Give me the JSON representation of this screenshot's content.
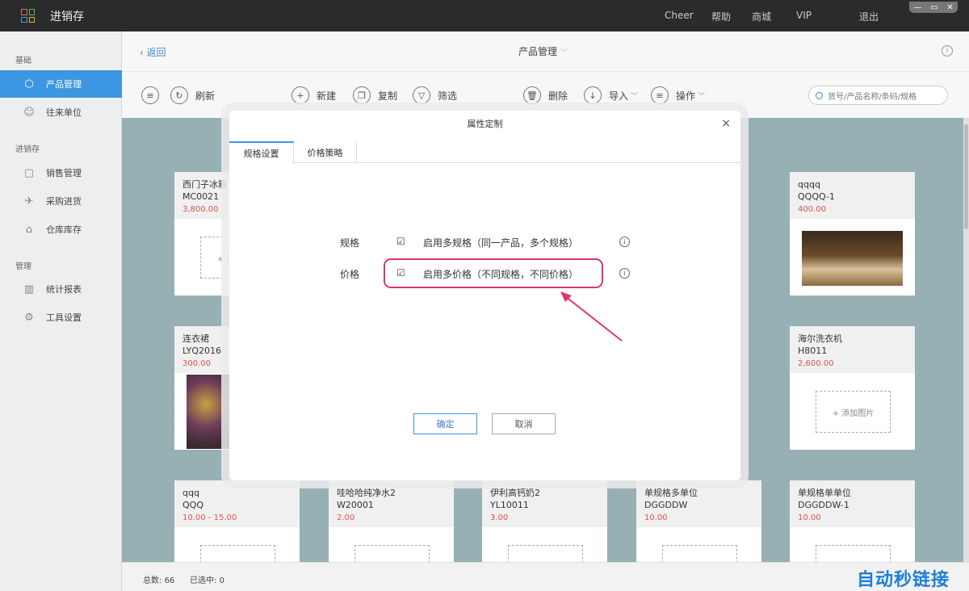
{
  "app": {
    "title": "进销存"
  },
  "topnav": {
    "items": [
      "Cheer",
      "帮助",
      "商城",
      "VIP",
      "退出"
    ],
    "win": [
      "—",
      "▭",
      "✕"
    ]
  },
  "sidebar": {
    "sections": [
      "基础",
      "进销存",
      "管理"
    ],
    "items": [
      {
        "label": "产品管理",
        "icon": "tag-icon"
      },
      {
        "label": "往来单位",
        "icon": "contacts-icon"
      },
      {
        "label": "销售管理",
        "icon": "clipboard-icon"
      },
      {
        "label": "采购进货",
        "icon": "plane-icon"
      },
      {
        "label": "仓库库存",
        "icon": "warehouse-icon"
      },
      {
        "label": "统计报表",
        "icon": "chart-icon"
      },
      {
        "label": "工具设置",
        "icon": "gear-icon"
      }
    ]
  },
  "header": {
    "back": "返回",
    "title": "产品管理",
    "title_suffix": "﹀"
  },
  "toolbar": {
    "refresh": "刷新",
    "new": "新建",
    "copy": "复制",
    "filter": "筛选",
    "delete": "删除",
    "import": "导入",
    "action": "操作",
    "search_placeholder": "货号/产品名称/条码/规格"
  },
  "cards": [
    {
      "name": "西门子冰箱",
      "code": "MC0021",
      "price": "3,800.00",
      "img": "add"
    },
    {
      "name": "qqqq",
      "code": "QQQQ-1",
      "price": "400.00",
      "img": "book"
    },
    {
      "name": "连衣裙",
      "code": "LYQ2016",
      "price": "300.00",
      "img": "photo"
    },
    {
      "name": "海尔洗衣机",
      "code": "H8011",
      "price": "2,600.00",
      "img": "add"
    },
    {
      "name": "qqq",
      "code": "QQQ",
      "price": "10.00 - 15.00",
      "img": "add"
    },
    {
      "name": "哇哈哈纯净水2",
      "code": "W20001",
      "price": "2.00",
      "img": "add"
    },
    {
      "name": "伊利高钙奶2",
      "code": "YL10011",
      "price": "3.00",
      "img": "add"
    },
    {
      "name": "单规格多单位",
      "code": "DGGDDW",
      "price": "10.00",
      "img": "add"
    },
    {
      "name": "单规格单单位",
      "code": "DGGDDW-1",
      "price": "10.00",
      "img": "add"
    }
  ],
  "add_image_label": "+ 添加图片",
  "footer": {
    "total_label": "总数:",
    "total": "66",
    "selected_label": "已选中:",
    "selected": "0",
    "watermark": "自动秒链接"
  },
  "dialog": {
    "title": "属性定制",
    "close": "×",
    "tabs": [
      "规格设置",
      "价格策略"
    ],
    "rows": [
      {
        "label": "规格",
        "text": "启用多规格（同一产品，多个规格）",
        "checked": true
      },
      {
        "label": "价格",
        "text": "启用多价格（不同规格，不同价格）",
        "checked": true
      }
    ],
    "confirm": "确定",
    "cancel": "取消"
  },
  "colors": {
    "accent": "#3c97e2",
    "highlight": "#e0336e",
    "price": "#d9534f"
  }
}
